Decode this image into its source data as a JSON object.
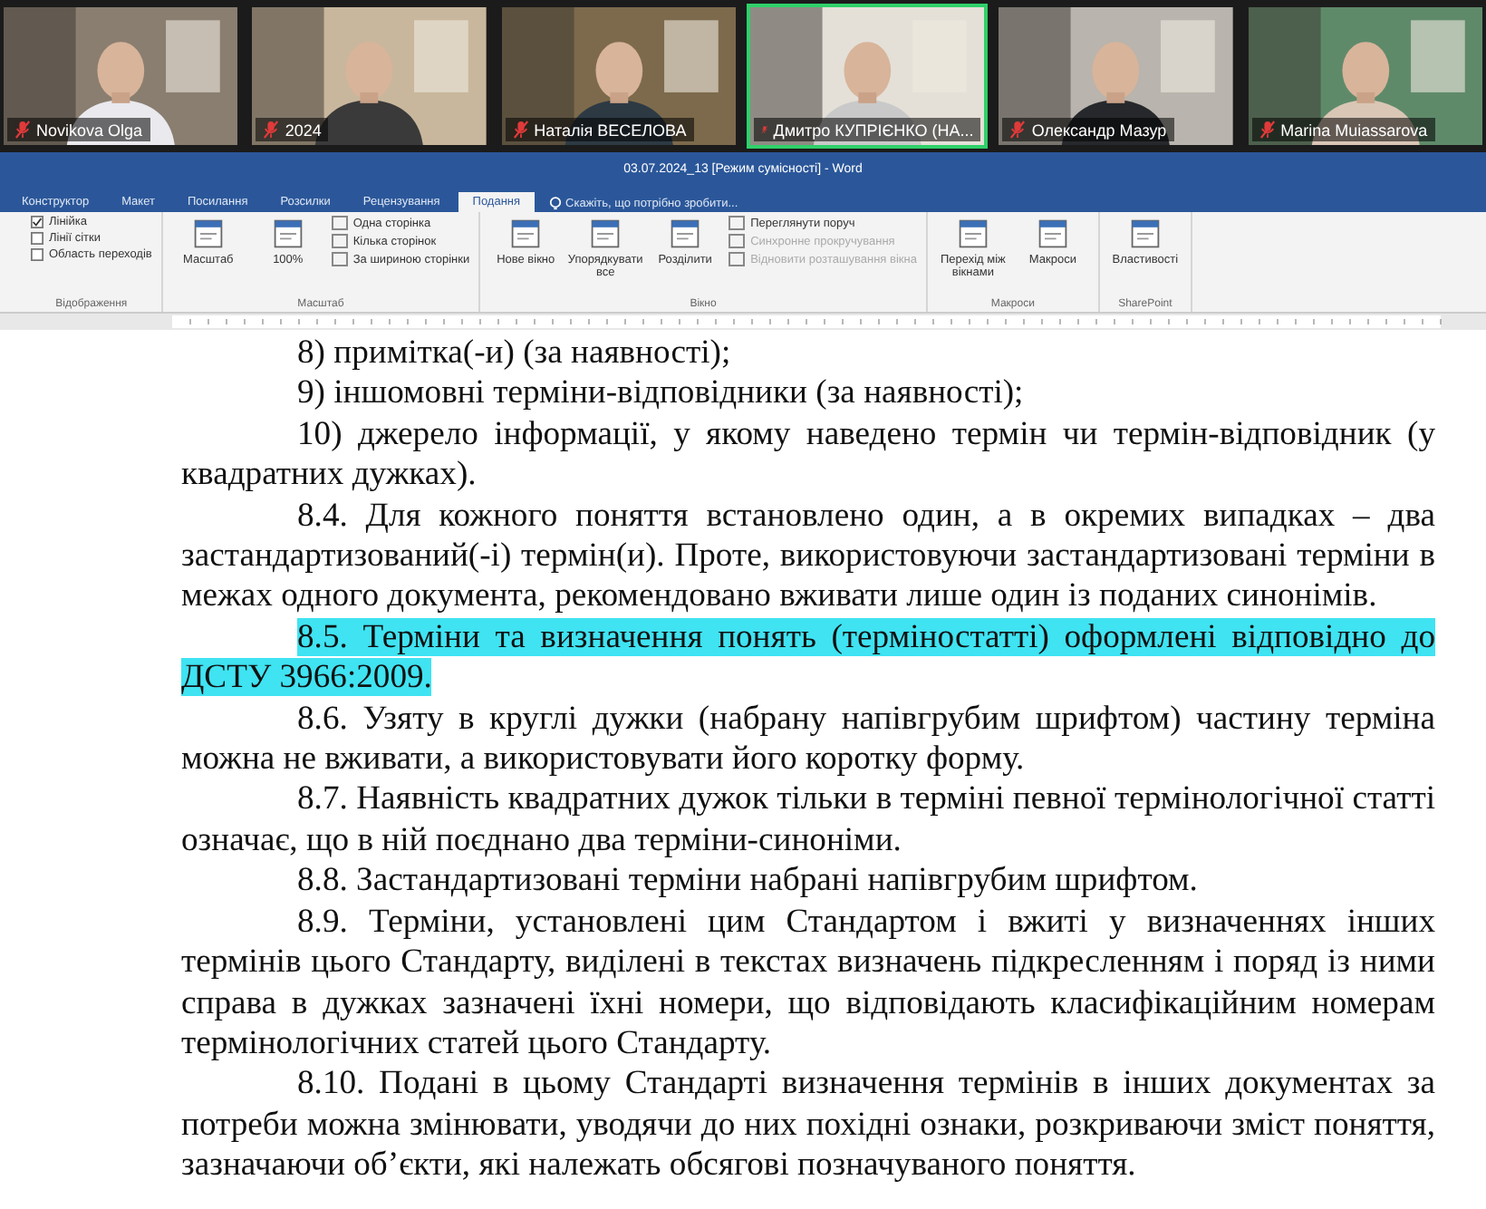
{
  "participants": [
    {
      "name": "Novikova Olga",
      "selected": false
    },
    {
      "name": "2024",
      "selected": false
    },
    {
      "name": "Наталія ВЕСЕЛОВА",
      "selected": false
    },
    {
      "name": "Дмитро КУПРІЄНКО (НА...",
      "selected": true
    },
    {
      "name": "Олександр Мазур",
      "selected": false
    },
    {
      "name": "Marina Muiassarova",
      "selected": false
    }
  ],
  "window": {
    "title": "03.07.2024_13 [Режим сумісності] - Word"
  },
  "tabs": [
    {
      "label": "Конструктор",
      "selected": false
    },
    {
      "label": "Макет",
      "selected": false
    },
    {
      "label": "Посилання",
      "selected": false
    },
    {
      "label": "Розсилки",
      "selected": false
    },
    {
      "label": "Рецензування",
      "selected": false
    },
    {
      "label": "Подання",
      "selected": true
    }
  ],
  "tell_me": {
    "placeholder": "Скажіть, що потрібно зробити..."
  },
  "ribbon": [
    {
      "label": "Відображення",
      "items": [
        {
          "kind": "checkbox",
          "label": "Лінійка",
          "checked": true
        },
        {
          "kind": "checkbox",
          "label": "Лінії сітки",
          "checked": false
        },
        {
          "kind": "checkbox",
          "label": "Область переходів",
          "checked": false
        }
      ]
    },
    {
      "label": "Масштаб",
      "items": [
        {
          "kind": "large",
          "label": "Масштаб"
        },
        {
          "kind": "large",
          "label": "100%"
        },
        {
          "kind": "small",
          "label": "Одна сторінка"
        },
        {
          "kind": "small",
          "label": "Кілька сторінок"
        },
        {
          "kind": "small",
          "label": "За шириною сторінки"
        }
      ]
    },
    {
      "label": "Вікно",
      "items": [
        {
          "kind": "large",
          "label": "Нове вікно"
        },
        {
          "kind": "large",
          "label": "Упорядкувати все"
        },
        {
          "kind": "large",
          "label": "Розділити"
        },
        {
          "kind": "small",
          "label": "Переглянути поруч",
          "disabled": false
        },
        {
          "kind": "small",
          "label": "Синхронне прокручування",
          "disabled": true
        },
        {
          "kind": "small",
          "label": "Відновити розташування вікна",
          "disabled": true
        }
      ]
    },
    {
      "label": "Макроси",
      "items": [
        {
          "kind": "large",
          "label": "Перехід між вікнами"
        },
        {
          "kind": "large",
          "label": "Макроси"
        }
      ]
    },
    {
      "label": "SharePoint",
      "items": [
        {
          "kind": "large",
          "label": "Властивості"
        }
      ]
    }
  ],
  "document": {
    "paragraphs": [
      {
        "text": "8) примітка(-и) (за наявності);",
        "highlighted": false
      },
      {
        "text": "9) іншомовні терміни-відповідники (за наявності);",
        "highlighted": false
      },
      {
        "text": "10) джерело інформації, у якому наведено термін чи термін-відповідник (у квадратних дужках).",
        "highlighted": false
      },
      {
        "text": "8.4. Для кожного поняття встановлено один, а в окремих випадках – два застандартизований(-і) термін(и). Проте, використовуючи застандартизовані терміни в межах одного документа, рекомендовано вживати лише один із поданих синонімів.",
        "highlighted": false
      },
      {
        "text": "8.5. Терміни та визначення понять (терміностатті) оформлені відповідно до ДСТУ 3966:2009.",
        "highlighted": true
      },
      {
        "text": "8.6. Узяту в круглі дужки (набрану напівгрубим шрифтом) частину терміна можна не вживати, а використовувати його коротку форму.",
        "highlighted": false
      },
      {
        "text": "8.7. Наявність квадратних дужок тільки в терміні певної термінологічної статті означає, що в ній поєднано два терміни-синоніми.",
        "highlighted": false
      },
      {
        "text": "8.8. Застандартизовані терміни набрані напівгрубим шрифтом.",
        "highlighted": false
      },
      {
        "text": "8.9. Терміни, установлені цим Стандартом і вжиті у визначеннях інших термінів цього Стандарту, виділені в текстах визначень підкресленням і поряд із ними справа в дужках зазначені їхні номери, що відповідають класифікаційним номерам термінологічних статей цього Стандарту.",
        "highlighted": false
      },
      {
        "text": "8.10. Подані в цьому Стандарті визначення термінів в інших документах за потреби можна змінювати, уводячи до них похідні ознаки, розкриваючи зміст поняття, зазначаючи об’єкти, які належать обсягові позначуваного поняття.",
        "highlighted": false
      }
    ]
  }
}
